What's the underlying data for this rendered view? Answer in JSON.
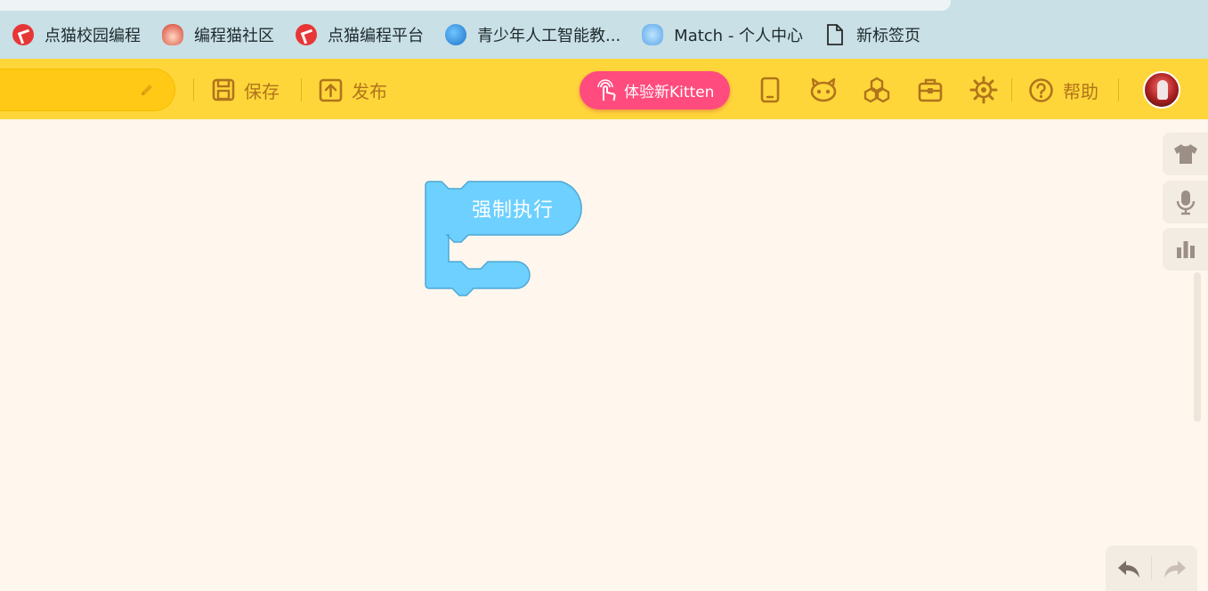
{
  "bookmarks": [
    {
      "label": "点猫校园编程",
      "icon": "dianmao-icon"
    },
    {
      "label": "编程猫社区",
      "icon": "codemao-cat-icon"
    },
    {
      "label": "点猫编程平台",
      "icon": "dianmao-icon"
    },
    {
      "label": "青少年人工智能教...",
      "icon": "globe-icon"
    },
    {
      "label": "Match - 个人中心",
      "icon": "bird-icon"
    },
    {
      "label": "新标签页",
      "icon": "page-icon"
    }
  ],
  "toolbar": {
    "save_label": "保存",
    "publish_label": "发布",
    "kitten_label": "体验新Kitten",
    "help_label": "帮助"
  },
  "workspace": {
    "block_label": "强制执行"
  },
  "colors": {
    "toolbar_bg": "#ffd63a",
    "accent_pink": "#ff4b7d",
    "block_blue": "#6dd0ff",
    "icon_brown": "#b0741b",
    "workspace_bg": "#fff7ed"
  }
}
